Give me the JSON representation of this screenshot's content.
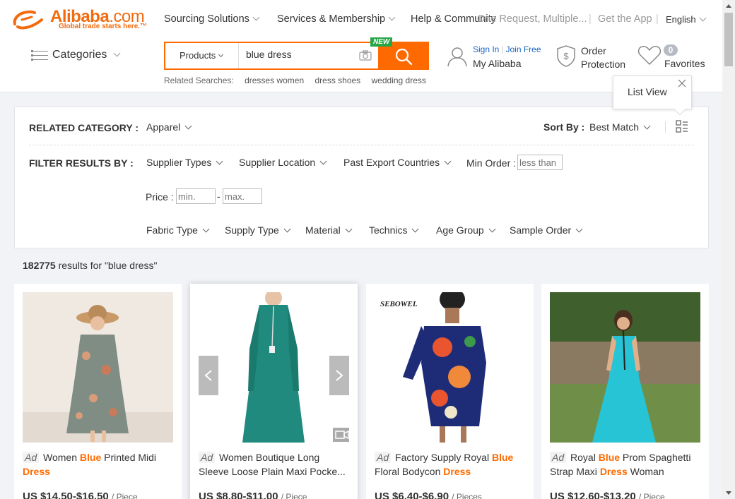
{
  "brand": {
    "name": "Alibaba",
    "suffix": ".com",
    "tagline": "Global trade starts here.™"
  },
  "topnav": {
    "items": [
      {
        "label": "Sourcing Solutions"
      },
      {
        "label": "Services & Membership"
      },
      {
        "label": "Help & Community"
      }
    ],
    "overlap_text": "One Request, Multiple...",
    "get_app": "Get the App",
    "language": "English"
  },
  "categories_label": "Categories",
  "search": {
    "scope": "Products",
    "query": "blue dress",
    "new_badge": "NEW"
  },
  "related": {
    "label": "Related Searches:",
    "items": [
      "dresses women",
      "dress shoes",
      "wedding dress"
    ]
  },
  "account": {
    "sign_in": "Sign In",
    "join_free": "Join Free",
    "my_alibaba": "My Alibaba"
  },
  "order_protection": {
    "line1": "Order",
    "line2": "Protection"
  },
  "favorites": {
    "count": "0",
    "label": "Favorites"
  },
  "list_view_popup": {
    "label": "List View"
  },
  "filters": {
    "related_category_label": "RELATED CATEGORY :",
    "related_category_value": "Apparel",
    "sort_label": "Sort By :",
    "sort_value": "Best Match",
    "filter_by_label": "FILTER RESULTS BY :",
    "row1": [
      "Supplier Types",
      "Supplier Location",
      "Past Export Countries"
    ],
    "min_order_label": "Min Order :",
    "min_order_placeholder": "less than",
    "price_label": "Price :",
    "price_min_placeholder": "min.",
    "price_max_placeholder": "max.",
    "price_sep": "-",
    "row3": [
      "Fabric Type",
      "Supply Type",
      "Material",
      "Technics",
      "Age Group",
      "Sample Order"
    ]
  },
  "results": {
    "count": "182775",
    "text": "results for \"blue dress\""
  },
  "products": [
    {
      "ad": "Ad",
      "pre": "Women ",
      "kw1": "Blue",
      "mid": " Printed Midi ",
      "kw2": "Dress",
      "post": "",
      "price": "US $14.50-$16.50",
      "unit": "/ Piece"
    },
    {
      "ad": "Ad",
      "pre": "Women Boutique Long Sleeve Loose Plain Maxi Pocke...",
      "kw1": "",
      "mid": "",
      "kw2": "",
      "post": "",
      "price": "US $8.80-$11.00",
      "unit": "/ Piece"
    },
    {
      "ad": "Ad",
      "pre": "Factory Supply Royal ",
      "kw1": "Blue",
      "mid": " Floral Bodycon ",
      "kw2": "Dress",
      "post": "",
      "price": "US $6.40-$6.90",
      "unit": "/ Pieces"
    },
    {
      "ad": "Ad",
      "pre": "Royal ",
      "kw1": "Blue",
      "mid": " Prom Spaghetti Strap Maxi ",
      "kw2": "Dress",
      "post": " Woman",
      "price": "US $12.60-$13.20",
      "unit": "/ Piece"
    }
  ],
  "image_brand_text": "SEBOWEL",
  "colors": {
    "accent": "#ff6a00",
    "link": "#1a66c4",
    "badge": "#26a646"
  }
}
